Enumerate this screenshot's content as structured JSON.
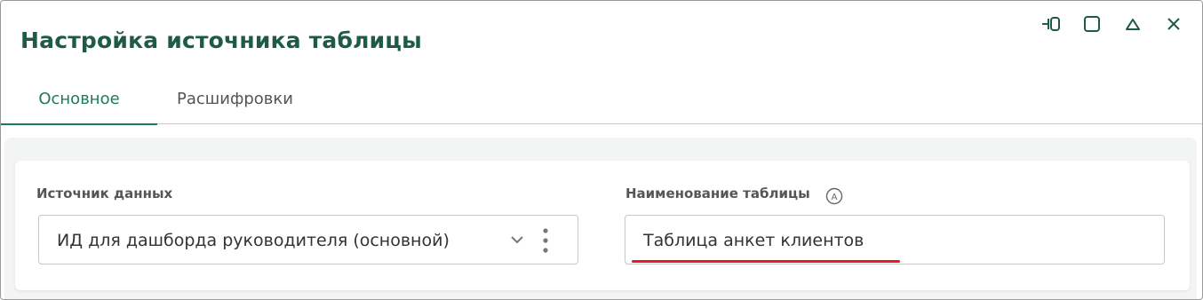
{
  "dialog": {
    "title": "Настройка источника таблицы",
    "window_controls": [
      "pin-icon",
      "maximize-icon",
      "collapse-icon",
      "close-icon"
    ]
  },
  "tabs": [
    {
      "label": "Основное",
      "active": true
    },
    {
      "label": "Расшифровки",
      "active": false
    }
  ],
  "form": {
    "source": {
      "label": "Источник данных",
      "value": "ИД для дашборда руководителя (основной)"
    },
    "table_name": {
      "label": "Наименование таблицы",
      "info_badge": "A",
      "value": "Таблица анкет клиентов"
    }
  },
  "colors": {
    "title": "#1e5a45",
    "accent": "#1e7a5a",
    "highlight_underline": "#e8182a"
  }
}
